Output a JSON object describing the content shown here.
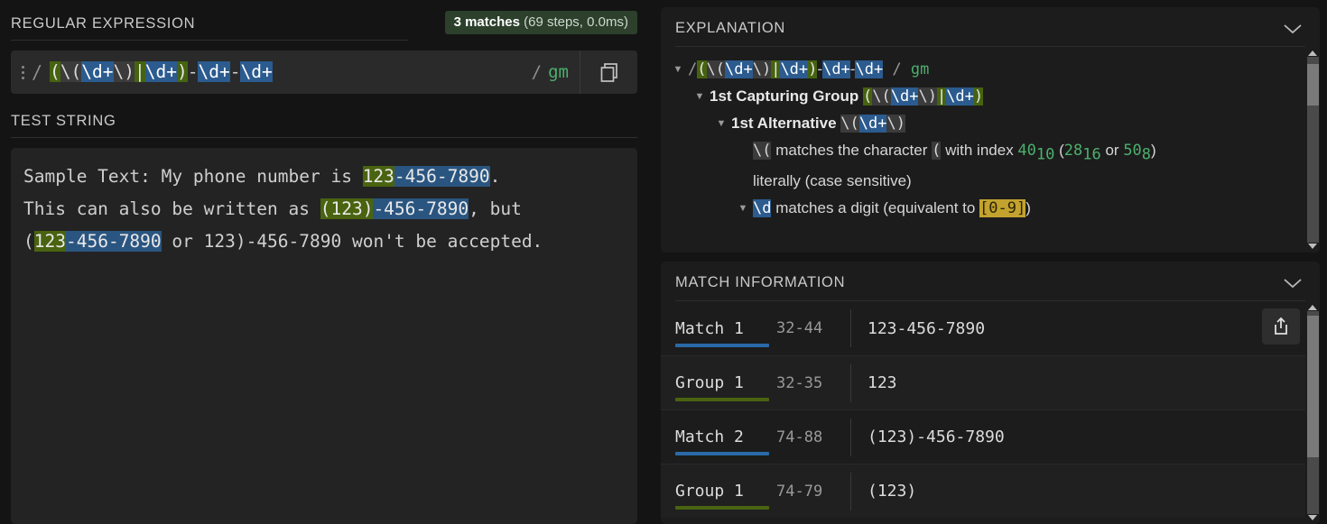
{
  "left": {
    "regex_section_title": "REGULAR EXPRESSION",
    "match_badge": {
      "count": "3 matches",
      "detail": "(69 steps, 0.0ms)"
    },
    "regex": {
      "delimiter": "/",
      "pattern": "(\\(\\d+\\)|\\d+)-\\d+-\\d+",
      "tokens": [
        {
          "t": "(",
          "c": "g"
        },
        {
          "t": "\\(",
          "c": "n"
        },
        {
          "t": "\\d+",
          "c": "b"
        },
        {
          "t": "\\)",
          "c": "n"
        },
        {
          "t": "|",
          "c": "g"
        },
        {
          "t": "\\d+",
          "c": "b"
        },
        {
          "t": ")",
          "c": "g"
        },
        {
          "t": "-",
          "c": "p"
        },
        {
          "t": "\\d+",
          "c": "b"
        },
        {
          "t": "-",
          "c": "p"
        },
        {
          "t": "\\d+",
          "c": "b"
        }
      ],
      "flags": "gm",
      "copy_icon": "copy-icon",
      "menu_icon": "kebab-menu-icon"
    },
    "test_section_title": "TEST STRING",
    "test_lines": [
      [
        {
          "t": "Sample Text: My phone number is ",
          "h": ""
        },
        {
          "t": "123",
          "h": "hg"
        },
        {
          "t": "-456-7890",
          "h": "hb"
        },
        {
          "t": ".",
          "h": ""
        }
      ],
      [
        {
          "t": "This can also be written as ",
          "h": ""
        },
        {
          "t": "(123)",
          "h": "hg"
        },
        {
          "t": "-456-7890",
          "h": "hb"
        },
        {
          "t": ", but",
          "h": ""
        }
      ],
      [
        {
          "t": "(",
          "h": ""
        },
        {
          "t": "123",
          "h": "hg"
        },
        {
          "t": "-456-7890",
          "h": "hb"
        },
        {
          "t": " or 123)-456-7890 won't be accepted.",
          "h": ""
        }
      ]
    ]
  },
  "explanation": {
    "title": "EXPLANATION",
    "collapse_icon": "chevron-down-icon",
    "rows": [
      {
        "indent": 0,
        "twisty": "open",
        "parts": [
          {
            "t": "/",
            "c": "plain-dim"
          },
          {
            "t": "(",
            "c": "ng"
          },
          {
            "t": "\\(",
            "c": "nn"
          },
          {
            "t": "\\d+",
            "c": "nb"
          },
          {
            "t": "\\)",
            "c": "nn"
          },
          {
            "t": "|",
            "c": "ng"
          },
          {
            "t": "\\d+",
            "c": "nb"
          },
          {
            "t": ")",
            "c": "ng"
          },
          {
            "t": "-",
            "c": "plain"
          },
          {
            "t": "\\d+",
            "c": "nb"
          },
          {
            "t": "-",
            "c": "plain"
          },
          {
            "t": "\\d+",
            "c": "nb"
          },
          {
            "t": " / ",
            "c": "plain-dim"
          },
          {
            "t": "gm",
            "c": "grn"
          }
        ]
      },
      {
        "indent": 1,
        "twisty": "open",
        "parts": [
          {
            "t": "1st Capturing Group ",
            "c": "bold"
          },
          {
            "t": "(",
            "c": "ng"
          },
          {
            "t": "\\(",
            "c": "nn"
          },
          {
            "t": "\\d+",
            "c": "nb"
          },
          {
            "t": "\\)",
            "c": "nn"
          },
          {
            "t": "|",
            "c": "ng"
          },
          {
            "t": "\\d+",
            "c": "nb"
          },
          {
            "t": ")",
            "c": "ng"
          }
        ]
      },
      {
        "indent": 2,
        "twisty": "open",
        "parts": [
          {
            "t": "1st Alternative ",
            "c": "bold"
          },
          {
            "t": "\\(",
            "c": "nn"
          },
          {
            "t": "\\d+",
            "c": "nb"
          },
          {
            "t": "\\)",
            "c": "nn"
          }
        ]
      },
      {
        "indent": 3,
        "twisty": "none",
        "parts": [
          {
            "t": "\\(",
            "c": "nn"
          },
          {
            "t": " matches the character ",
            "c": "plain"
          },
          {
            "t": "(",
            "c": "nn"
          },
          {
            "t": " with index ",
            "c": "plain"
          },
          {
            "t": "40",
            "c": "grn",
            "sub": "10"
          },
          {
            "t": " (",
            "c": "plain"
          },
          {
            "t": "28",
            "c": "grn",
            "sub": "16"
          },
          {
            "t": " or ",
            "c": "plain"
          },
          {
            "t": "50",
            "c": "grn",
            "sub": "8"
          },
          {
            "t": ")",
            "c": "plain"
          }
        ]
      },
      {
        "indent": 3,
        "twisty": "none",
        "parts": [
          {
            "t": "literally (case sensitive)",
            "c": "plain"
          }
        ]
      },
      {
        "indent": 3,
        "twisty": "open",
        "parts": [
          {
            "t": "\\d",
            "c": "nb"
          },
          {
            "t": " matches a digit (equivalent to ",
            "c": "plain"
          },
          {
            "t": "[0-9]",
            "c": "yel"
          },
          {
            "t": ")",
            "c": "plain"
          }
        ]
      }
    ],
    "scrollbar": {
      "thumb_top_pct": 4,
      "thumb_height_pct": 22
    }
  },
  "match_information": {
    "title": "MATCH INFORMATION",
    "collapse_icon": "chevron-down-icon",
    "export_icon": "export-icon",
    "colors": {
      "match_underline": "#2a6aa8",
      "group_underline": "#4a6310"
    },
    "rows": [
      {
        "label": "Match 1",
        "range": "32-44",
        "value": "123-456-7890",
        "kind": "match"
      },
      {
        "label": "Group 1",
        "range": "32-35",
        "value": "123",
        "kind": "group"
      },
      {
        "label": "Match 2",
        "range": "74-88",
        "value": "(123)-456-7890",
        "kind": "match"
      },
      {
        "label": "Group 1",
        "range": "74-79",
        "value": "(123)",
        "kind": "group"
      }
    ],
    "scrollbar": {
      "thumb_top_pct": 2,
      "thumb_height_pct": 70
    }
  }
}
